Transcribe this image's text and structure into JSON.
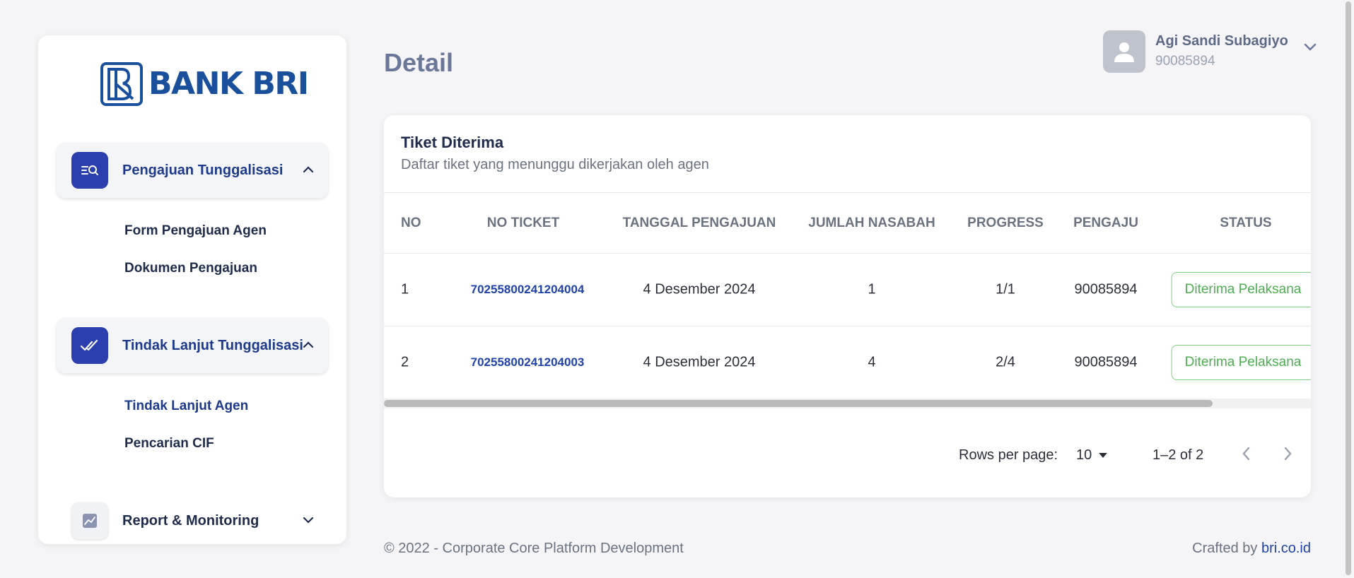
{
  "brand": {
    "logo_text": "BANK BRI"
  },
  "sidebar": {
    "groups": [
      {
        "label": "Pengajuan Tunggalisasi",
        "icon": "search-list-icon",
        "expanded": true,
        "items": [
          {
            "label": "Form Pengajuan Agen"
          },
          {
            "label": "Dokumen Pengajuan"
          }
        ]
      },
      {
        "label": "Tindak Lanjut Tunggalisasi",
        "icon": "double-check-icon",
        "expanded": true,
        "items": [
          {
            "label": "Tindak Lanjut Agen"
          },
          {
            "label": "Pencarian CIF"
          }
        ]
      },
      {
        "label": "Report & Monitoring",
        "icon": "chart-icon",
        "expanded": false,
        "items": []
      }
    ]
  },
  "header": {
    "title": "Detail",
    "user": {
      "name": "Agi Sandi Subagiyo",
      "id": "90085894"
    }
  },
  "card": {
    "title": "Tiket Diterima",
    "subtitle": "Daftar tiket yang menunggu dikerjakan oleh agen",
    "columns": [
      "NO",
      "NO TICKET",
      "TANGGAL PENGAJUAN",
      "JUMLAH NASABAH",
      "PROGRESS",
      "PENGAJU",
      "STATUS"
    ],
    "rows": [
      {
        "no": "1",
        "ticket": "70255800241204004",
        "date": "4 Desember 2024",
        "nasabah": "1",
        "progress": "1/1",
        "pengaju": "90085894",
        "status": "Diterima Pelaksana"
      },
      {
        "no": "2",
        "ticket": "70255800241204003",
        "date": "4 Desember 2024",
        "nasabah": "4",
        "progress": "2/4",
        "pengaju": "90085894",
        "status": "Diterima Pelaksana"
      }
    ],
    "pagination": {
      "rows_label": "Rows per page:",
      "rows_value": "10",
      "range": "1–2 of 2"
    }
  },
  "footer": {
    "copyright": "© 2022 - Corporate Core Platform Development",
    "crafted_prefix": "Crafted by ",
    "crafted_link": "bri.co.id"
  },
  "colors": {
    "primary": "#2a3eae",
    "brand": "#1a4f9c",
    "status_green": "#4caf50",
    "link": "#2142a8"
  }
}
